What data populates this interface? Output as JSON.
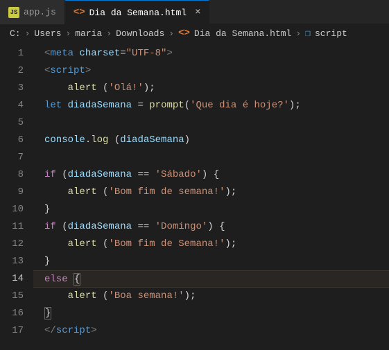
{
  "tabs": [
    {
      "label": "app.js",
      "iconText": "JS"
    },
    {
      "label": "Dia da Semana.html",
      "active": true
    }
  ],
  "breadcrumb": {
    "parts": [
      "C:",
      "Users",
      "maria",
      "Downloads"
    ],
    "file": "Dia da Semana.html",
    "symbol": "script"
  },
  "activeLine": 14,
  "chart_data": {
    "type": "code",
    "language": "html_with_js",
    "code_lines": [
      "<meta charset=\"UTF-8\">",
      "<script>",
      "    alert ('Olá!');",
      "let diadaSemana = prompt('Que dia é hoje?');",
      "",
      "console.log (diadaSemana)",
      "",
      "if (diadaSemana == 'Sábado') {",
      "    alert ('Bom fim de semana!');",
      "}",
      "if (diadaSemana == 'Domingo') {",
      "    alert ('Bom fim de Semana!');",
      "}",
      "else {",
      "    alert ('Boa semana!');",
      "}",
      "</script>"
    ]
  },
  "tokens": {
    "meta_open": "<",
    "meta_tag": "meta",
    "charset_attr": "charset",
    "eq": "=",
    "utf8": "\"UTF-8\"",
    "close": ">",
    "script_open": "<",
    "script_tag": "script",
    "alert": "alert",
    "ola": "'Olá!'",
    "let": "let",
    "diadaSemana": "diadaSemana",
    "assign": " = ",
    "prompt": "prompt",
    "quedia": "'Que dia é hoje?'",
    "console": "console",
    "dot": ".",
    "log": "log",
    "if": "if",
    "eqeq": " == ",
    "sabado": "'Sábado'",
    "bomfim1": "'Bom fim de semana!'",
    "domingo": "'Domingo'",
    "bomfim2": "'Bom fim de Semana!'",
    "else": "else",
    "boasemana": "'Boa semana!'",
    "end_open": "</",
    "lbrace": "{",
    "rbrace": "}",
    "lparen": "(",
    "rparen": ")",
    "sp_lparen": " (",
    "rparen_sp": ") ",
    "semi": ";",
    "indent1": "    "
  }
}
